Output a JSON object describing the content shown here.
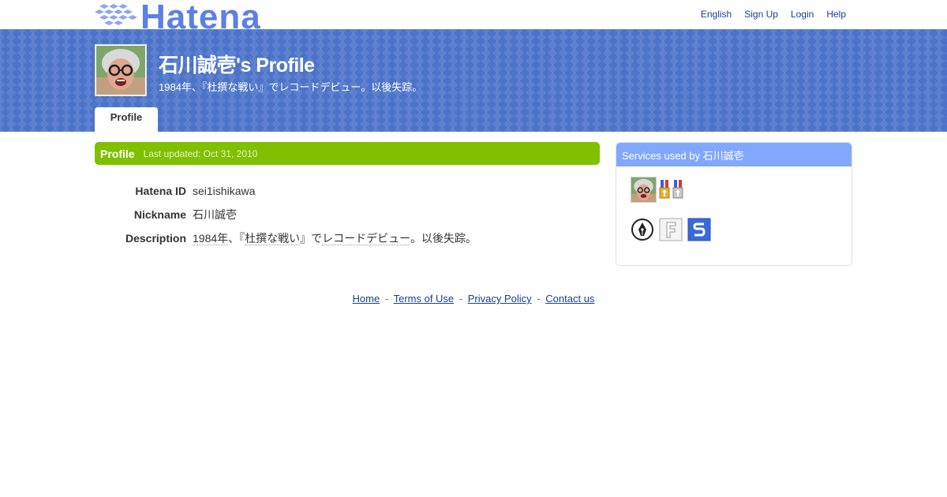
{
  "brand": {
    "logo_text": "Hatena"
  },
  "topnav": {
    "english": "English",
    "signup": "Sign Up",
    "login": "Login",
    "help": "Help"
  },
  "header": {
    "title": "石川誠壱's Profile",
    "subtitle": "1984年、『杜撰な戦い』でレコードデビュー。以後失踪。",
    "tab_profile": "Profile"
  },
  "profile": {
    "section_title": "Profile",
    "last_updated": "Last updated: Oct 31, 2010",
    "fields": {
      "hatena_id_label": "Hatena ID",
      "hatena_id_value": "sei1ishikawa",
      "nickname_label": "Nickname",
      "nickname_value": "石川誠壱",
      "description_label": "Description",
      "description_parts": [
        "1984年",
        "、『",
        "杜撰な戦い",
        "』で",
        "レコードデビュー",
        "。以後失踪。"
      ]
    }
  },
  "services": {
    "title": "Services used by 石川誠壱"
  },
  "footer": {
    "home": "Home",
    "terms": "Terms of Use",
    "privacy": "Privacy Policy",
    "contact": "Contact us",
    "sep": "-"
  },
  "colors": {
    "profile_bar": "#80c000",
    "services_bar": "#80a8ff",
    "header_band": "#4b73c9",
    "link": "#1a3f8f",
    "logo": "#5b80e6"
  },
  "icons": [
    "hatena-logo-icon",
    "user-avatar",
    "gold-medal-icon",
    "silver-medal-icon",
    "pen-nib-icon",
    "fotolife-f-icon",
    "haiku-s-icon"
  ]
}
